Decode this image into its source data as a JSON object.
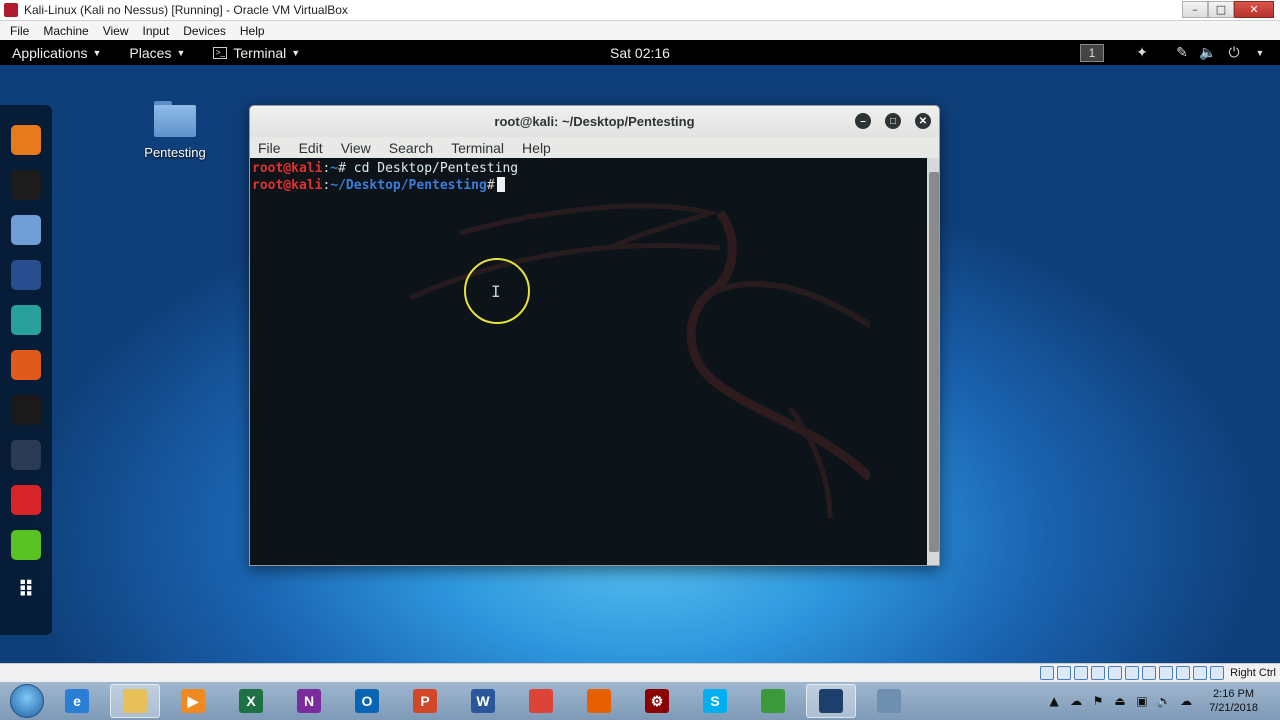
{
  "host_window": {
    "title": "Kali-Linux (Kali no Nessus) [Running] - Oracle VM VirtualBox",
    "menu": [
      "File",
      "Machine",
      "View",
      "Input",
      "Devices",
      "Help"
    ],
    "controls": {
      "minimize": "–",
      "maximize": "□",
      "close": "✕"
    }
  },
  "gnome_bar": {
    "applications": "Applications",
    "places": "Places",
    "terminal": "Terminal",
    "clock": "Sat 02:16",
    "workspace": "1",
    "icons": [
      "accessibility-icon",
      "pen-icon",
      "volume-icon",
      "power-icon"
    ]
  },
  "dock": {
    "items": [
      "firefox-icon",
      "terminal-icon",
      "files-icon",
      "metasploit-icon",
      "armitage-icon",
      "burpsuite-icon",
      "maltego-icon",
      "beef-icon",
      "faraday-icon",
      "leafpad-icon",
      "show-apps-icon"
    ],
    "colors": [
      "#e87a1e",
      "#1c1c1c",
      "#6f9fd6",
      "#2a4d8f",
      "#2aa09a",
      "#e05a1b",
      "#1a1a1a",
      "#2b3b55",
      "#d9232a",
      "#58c322",
      "#ffffff"
    ]
  },
  "desktop": {
    "folder_label": "Pentesting"
  },
  "terminal": {
    "title": "root@kali: ~/Desktop/Pentesting",
    "menu": [
      "File",
      "Edit",
      "View",
      "Search",
      "Terminal",
      "Help"
    ],
    "lines": [
      {
        "user": "root@kali",
        "sep": ":",
        "path": "~",
        "sym": "# ",
        "cmd": "cd Desktop/Pentesting"
      },
      {
        "user": "root@kali",
        "sep": ":",
        "path": "~/Desktop/Pentesting",
        "sym": "#",
        "cmd": ""
      }
    ],
    "colors": {
      "background": "#0c1419",
      "user": "#e0322e",
      "path": "#3b7dd8"
    }
  },
  "status_bar": {
    "host_key": "Right Ctrl"
  },
  "taskbar": {
    "apps": [
      {
        "name": "ie-icon",
        "color": "#2a7fd4",
        "glyph": "e"
      },
      {
        "name": "file-explorer-icon",
        "color": "#e6c15a",
        "glyph": ""
      },
      {
        "name": "media-player-icon",
        "color": "#f08a1e",
        "glyph": "▶"
      },
      {
        "name": "excel-icon",
        "color": "#1e7145",
        "glyph": "X"
      },
      {
        "name": "onenote-icon",
        "color": "#7b2c9c",
        "glyph": "N"
      },
      {
        "name": "outlook-icon",
        "color": "#0a64b4",
        "glyph": "O"
      },
      {
        "name": "powerpoint-icon",
        "color": "#d24726",
        "glyph": "P"
      },
      {
        "name": "word-icon",
        "color": "#2b579a",
        "glyph": "W"
      },
      {
        "name": "chrome-icon",
        "color": "#db4437",
        "glyph": ""
      },
      {
        "name": "firefox-icon",
        "color": "#e66000",
        "glyph": ""
      },
      {
        "name": "gear-app-icon",
        "color": "#8b0000",
        "glyph": "⚙"
      },
      {
        "name": "skype-icon",
        "color": "#00aff0",
        "glyph": "S"
      },
      {
        "name": "android-emulator-icon",
        "color": "#3a9a3a",
        "glyph": ""
      },
      {
        "name": "virtualbox-icon",
        "color": "#1c3f6e",
        "glyph": ""
      },
      {
        "name": "recording-icon",
        "color": "#6f8fb0",
        "glyph": ""
      }
    ],
    "active_index": [
      1,
      13
    ],
    "clock_time": "2:16 PM",
    "clock_date": "7/21/2018"
  }
}
